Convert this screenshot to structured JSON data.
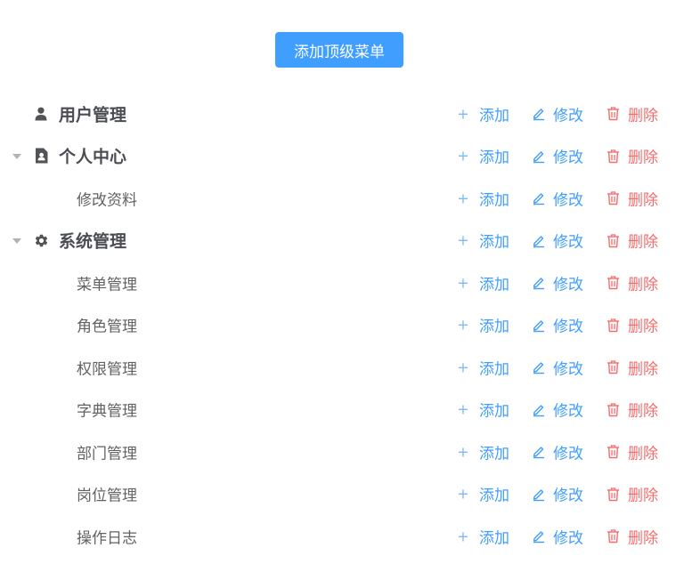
{
  "toolbar": {
    "add_top_menu_label": "添加顶级菜单"
  },
  "actions": {
    "add": "添加",
    "edit": "修改",
    "delete": "删除"
  },
  "colors": {
    "primary": "#409eff",
    "danger": "#f56c6c",
    "text": "#606266"
  },
  "tree": [
    {
      "label": "用户管理",
      "level": 1,
      "icon": "user-icon",
      "expandable": false
    },
    {
      "label": "个人中心",
      "level": 1,
      "icon": "profile-badge-icon",
      "expandable": true,
      "expanded": true
    },
    {
      "label": "修改资料",
      "level": 2
    },
    {
      "label": "系统管理",
      "level": 1,
      "icon": "gear-icon",
      "expandable": true,
      "expanded": true
    },
    {
      "label": "菜单管理",
      "level": 2
    },
    {
      "label": "角色管理",
      "level": 2
    },
    {
      "label": "权限管理",
      "level": 2
    },
    {
      "label": "字典管理",
      "level": 2
    },
    {
      "label": "部门管理",
      "level": 2
    },
    {
      "label": "岗位管理",
      "level": 2
    },
    {
      "label": "操作日志",
      "level": 2
    }
  ]
}
